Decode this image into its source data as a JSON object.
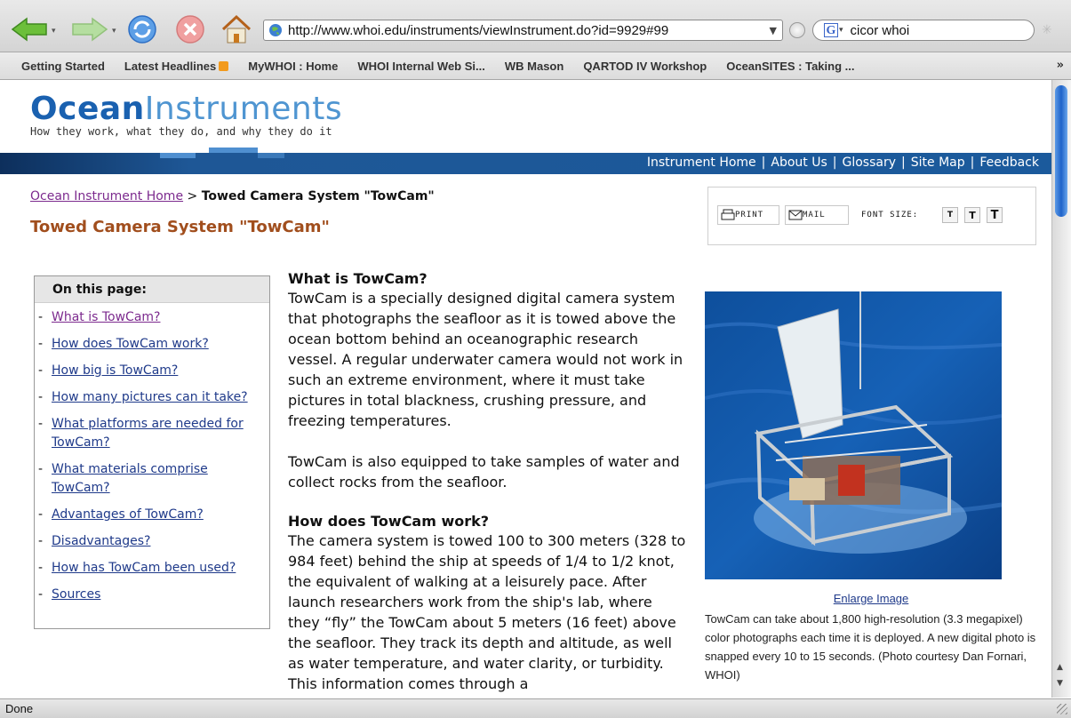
{
  "browser": {
    "url": "http://www.whoi.edu/instruments/viewInstrument.do?id=9929#99",
    "search_query": "cicor whoi",
    "search_engine_letter": "G",
    "status": "Done",
    "icons": [
      "back-icon",
      "forward-icon",
      "reload-icon",
      "stop-icon",
      "home-icon",
      "globe-icon",
      "go-icon",
      "google-icon",
      "throbber-icon"
    ]
  },
  "bookmarks": [
    "Getting Started",
    "Latest Headlines",
    "MyWHOI : Home",
    "WHOI Internal Web Si...",
    "WB Mason",
    "QARTOD IV Workshop",
    "OceanSITES : Taking ..."
  ],
  "site": {
    "logo_part1": "Ocean",
    "logo_part2": "Instruments",
    "tagline": "How they work, what they do, and why they do it",
    "nav": [
      "Instrument Home",
      "About Us",
      "Glossary",
      "Site Map",
      "Feedback"
    ],
    "colors": {
      "navbar": "#1b5a9c",
      "logo_dark": "#1a61b0",
      "logo_light": "#4f95d1",
      "title": "#a14e1d"
    }
  },
  "breadcrumb": {
    "home": "Ocean Instrument Home",
    "separator": ">",
    "current": "Towed Camera System \"TowCam\""
  },
  "page_title": "Towed Camera System \"TowCam\"",
  "tools": {
    "print": "PRINT",
    "mail": "MAIL",
    "font_size_label": "FONT SIZE:",
    "size_buttons": [
      "T",
      "T",
      "T"
    ]
  },
  "on_this_page": {
    "heading": "On this page:",
    "items": [
      "What is TowCam?",
      "How does TowCam work?",
      "How big is TowCam?",
      "How many pictures can it take?",
      "What platforms are needed for TowCam?",
      "What materials comprise TowCam?",
      "Advantages of TowCam?",
      "Disadvantages?",
      "How has TowCam been used?",
      "Sources"
    ]
  },
  "article": {
    "h1": "What is TowCam?",
    "p1": "TowCam is a specially designed digital camera system that photographs the seafloor as it is towed above the ocean bottom behind an oceanographic research vessel. A regular underwater camera would not work in such an extreme environment, where it must take pictures in total blackness, crushing pressure, and freezing temperatures.",
    "p2": "TowCam is also equipped to take samples of water and collect rocks from the seafloor.",
    "h2": "How does TowCam work?",
    "p3": "The camera system is towed 100 to 300 meters (328 to 984 feet) behind the ship at speeds of 1/4 to 1/2 knot, the equivalent of walking at a leisurely pace. After launch researchers work from the ship's lab, where they “fly” the TowCam about 5 meters (16 feet) above the seafloor. They track its depth and altitude, as well as water temperature, and water clarity, or turbidity. This information comes through a"
  },
  "figure": {
    "enlarge": "Enlarge Image",
    "caption": "TowCam can take about 1,800 high-resolution (3.3 megapixel) color photographs each time it is deployed. A new digital photo is snapped every 10 to 15 seconds. (Photo courtesy Dan Fornari, WHOI)"
  }
}
